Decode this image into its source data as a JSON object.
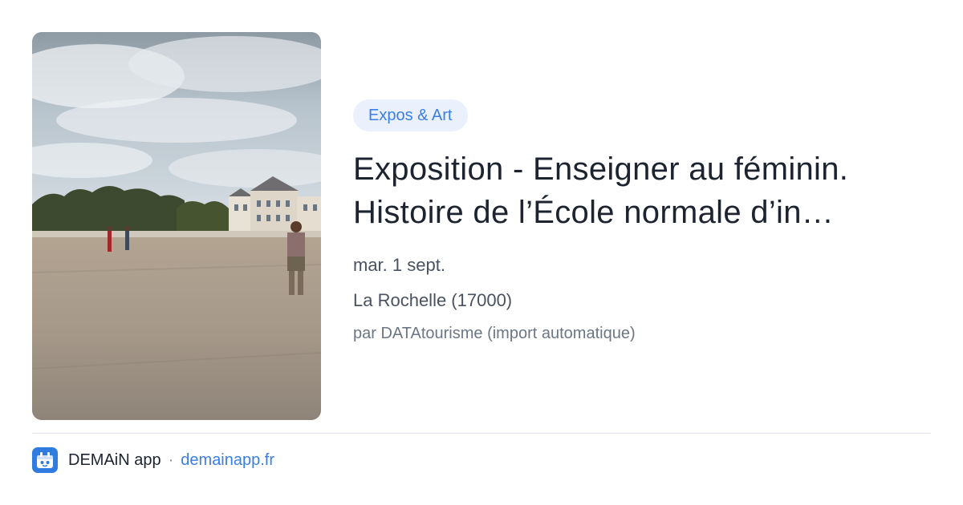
{
  "event": {
    "category": "Expos & Art",
    "title_line1": "Exposition - Enseigner au féminin.",
    "title_line2": "Histoire de l’École normale d’in…",
    "date": "mar. 1 sept.",
    "location": "La Rochelle (17000)",
    "source": "par DATAtourisme (import automatique)"
  },
  "footer": {
    "app_icon": "demain-app-logo-icon",
    "app_name": "DEMAiN app",
    "separator": "·",
    "domain": "demainapp.fr"
  },
  "colors": {
    "accent": "#3b7ee6",
    "badge_bg": "#eaf1fd",
    "title": "#1d2430",
    "meta": "#4a5260",
    "muted": "#6d7684"
  }
}
